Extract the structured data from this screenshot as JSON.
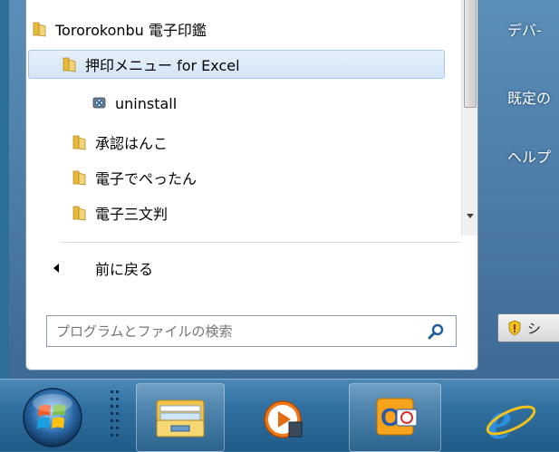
{
  "programs": {
    "items": [
      {
        "label": "Tororokonbu 電子印鑑",
        "type": "folder"
      },
      {
        "label": "押印メニュー for Excel",
        "type": "folder",
        "selected": true
      },
      {
        "label": "uninstall",
        "type": "app"
      },
      {
        "label": "承認はんこ",
        "type": "folder"
      },
      {
        "label": "電子でぺったん",
        "type": "folder"
      },
      {
        "label": "電子三文判",
        "type": "folder"
      }
    ]
  },
  "back": {
    "label": "前に戻る"
  },
  "search": {
    "placeholder": "プログラムとファイルの検索"
  },
  "right_pane": {
    "items": [
      "デバ-",
      "既定の",
      "ヘルプ"
    ]
  },
  "shutdown": {
    "label": "シ"
  },
  "taskbar": {
    "items": [
      "start-orb",
      "file-explorer-icon",
      "media-player-icon",
      "outlook-icon",
      "internet-explorer-icon"
    ]
  },
  "colors": {
    "frame": "#4c7ba6",
    "taskbar": "#2f6f9f",
    "selection": "#d3e5f7",
    "folder": "#e8b93a"
  }
}
